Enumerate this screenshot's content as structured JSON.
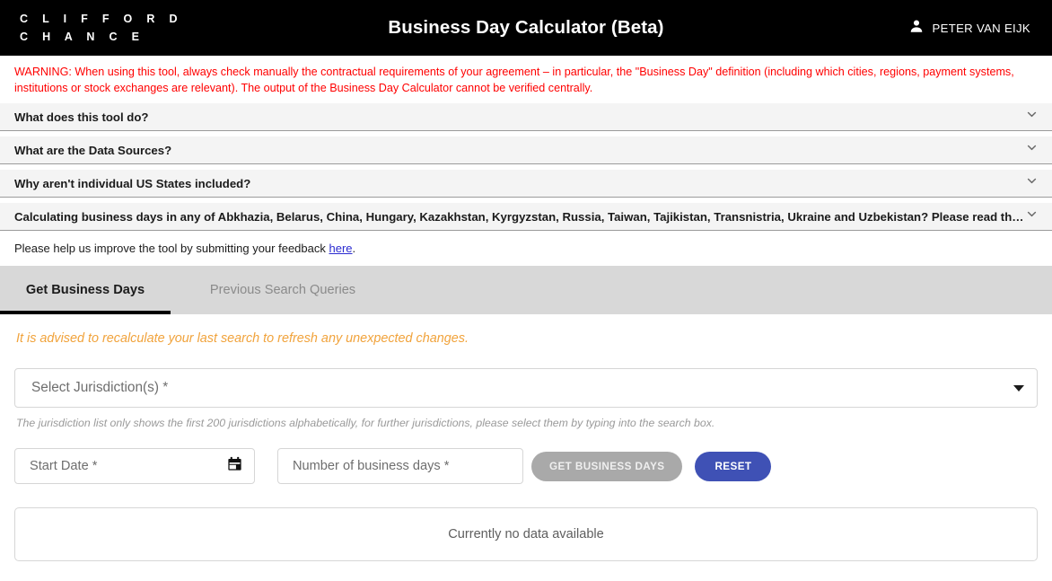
{
  "header": {
    "brand_line1": "C L I F F O R D",
    "brand_line2": "C H A N C E",
    "title": "Business Day Calculator (Beta)",
    "user_name": "PETER VAN EIJK",
    "user_icon": "person-icon",
    "background_color": "#000000",
    "text_color": "#ffffff"
  },
  "warning": {
    "text": "WARNING: When using this tool, always check manually the contractual requirements of your agreement – in particular, the \"Business Day\" definition (including which cities, regions, payment systems, institutions or stock exchanges are relevant). The output of the Business Day Calculator cannot be verified centrally.",
    "color": "#ff0000"
  },
  "accordions": [
    {
      "label": "What does this tool do?",
      "icon": "chevron-down-icon",
      "expanded": false
    },
    {
      "label": "What are the Data Sources?",
      "icon": "chevron-down-icon",
      "expanded": false
    },
    {
      "label": "Why aren't individual US States included?",
      "icon": "chevron-down-icon",
      "expanded": false
    },
    {
      "label": "Calculating business days in any of Abkhazia, Belarus, China, Hungary, Kazakhstan, Kyrgyzstan, Russia, Taiwan, Tajikistan, Transnistria, Ukraine and Uzbekistan? Please read this.",
      "icon": "chevron-down-icon",
      "expanded": false
    }
  ],
  "feedback": {
    "text_before": "Please help us improve the tool by submitting your feedback ",
    "link_label": "here",
    "text_after": ".",
    "link_color": "#2b2bd0"
  },
  "tabs": [
    {
      "label": "Get Business Days",
      "active": true
    },
    {
      "label": "Previous Search Queries",
      "active": false
    }
  ],
  "form": {
    "advisory": "It is advised to recalculate your last search to refresh any unexpected changes.",
    "advisory_color": "#f1a33c",
    "jurisdiction": {
      "placeholder": "Select Jurisdiction(s) *",
      "caret_icon": "caret-down-icon",
      "hint": "The jurisdiction list only shows the first 200 jurisdictions alphabetically, for further jurisdictions, please select them by typing into the search box.",
      "value": ""
    },
    "start_date": {
      "placeholder": "Start Date *",
      "value": "",
      "icon": "calendar-icon"
    },
    "business_days": {
      "placeholder": "Number of business days *",
      "value": ""
    },
    "submit_button": {
      "label": "GET BUSINESS DAYS",
      "disabled": true,
      "color": "#a9a9a9"
    },
    "reset_button": {
      "label": "RESET",
      "color": "#3f51b5"
    }
  },
  "results": {
    "empty_message": "Currently no data available"
  }
}
